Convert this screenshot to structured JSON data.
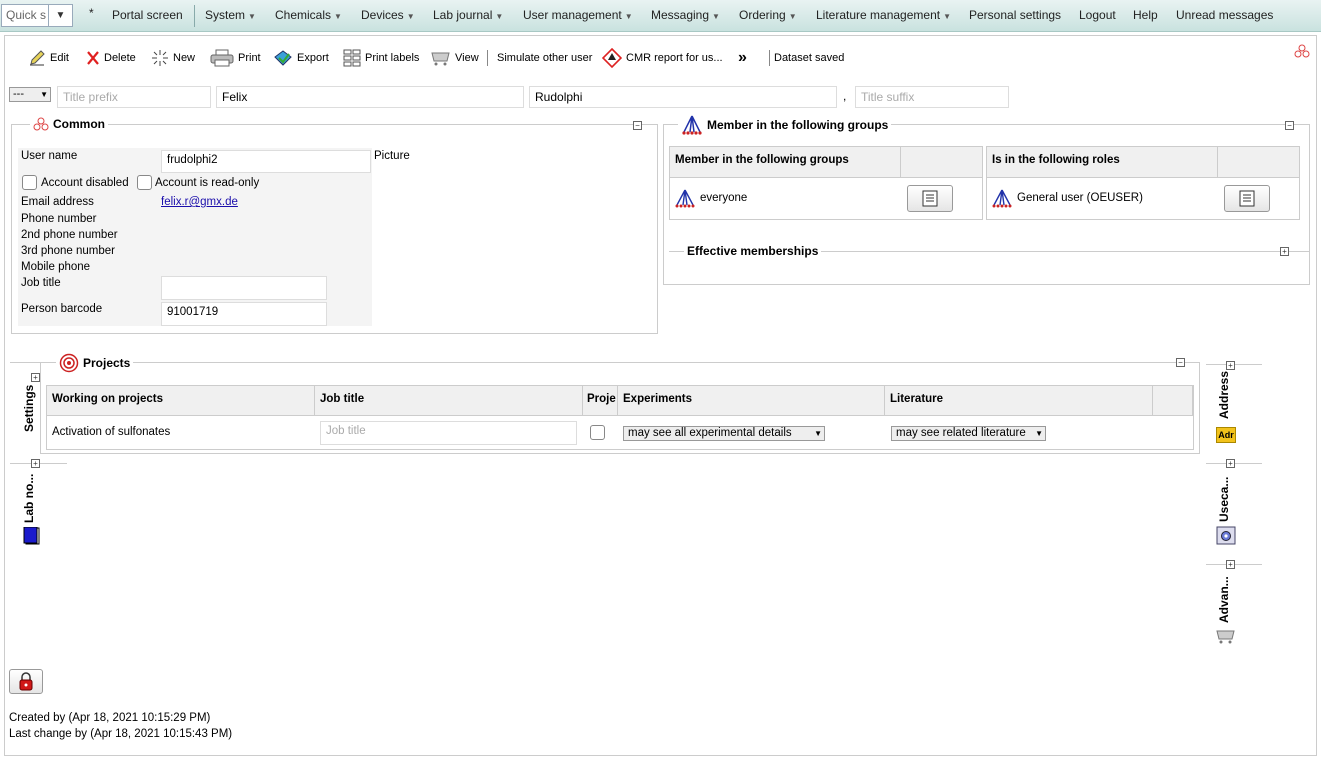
{
  "menu": {
    "quick_search_placeholder": "Quick s",
    "star": "*",
    "items": [
      "Portal screen",
      "System",
      "Chemicals",
      "Devices",
      "Lab journal",
      "User management",
      "Messaging",
      "Ordering",
      "Literature management",
      "Personal settings",
      "Logout",
      "Help",
      "Unread messages"
    ]
  },
  "toolbar": {
    "edit": "Edit",
    "delete": "Delete",
    "new": "New",
    "print": "Print",
    "export": "Export",
    "print_labels": "Print labels",
    "view": "View",
    "simulate": "Simulate other user",
    "cmr": "CMR report for us...",
    "more": "»",
    "status": "Dataset saved"
  },
  "name_row": {
    "salutation": "---",
    "title_prefix_placeholder": "Title prefix",
    "first_name": "Felix",
    "last_name": "Rudolphi",
    "comma": ",",
    "title_suffix_placeholder": "Title suffix"
  },
  "common": {
    "legend": "Common",
    "user_name_label": "User name",
    "user_name": "frudolphi2",
    "picture_label": "Picture",
    "account_disabled": "Account disabled",
    "account_readonly": "Account is read-only",
    "email_label": "Email address",
    "email": "felix.r@gmx.de",
    "phone_label": "Phone number",
    "phone2_label": "2nd phone number",
    "phone3_label": "3rd phone number",
    "mobile_label": "Mobile phone",
    "job_title_label": "Job title",
    "barcode_label": "Person barcode",
    "barcode": "91001719"
  },
  "groups": {
    "legend": "Member in the following groups",
    "groups_header": "Member in the following groups",
    "roles_header": "Is in the following roles",
    "group_item": "everyone",
    "role_item": "General user (OEUSER)",
    "effective_legend": "Effective memberships"
  },
  "projects": {
    "legend": "Projects",
    "headers": [
      "Working on projects",
      "Job title",
      "Proje",
      "Experiments",
      "Literature"
    ],
    "row": {
      "project": "Activation of sulfonates",
      "job_title_placeholder": "Job title",
      "experiments": "may see all experimental details",
      "literature": "may see related literature"
    }
  },
  "side_tabs": {
    "settings": "Settings",
    "lab_notebook": "Lab no...",
    "address": "Address",
    "address_icon_text": "Adr",
    "usecases": "Useca...",
    "advanced": "Advan..."
  },
  "footer": {
    "created": "Created by (Apr 18, 2021 10:15:29 PM)",
    "changed": "Last change by (Apr 18, 2021 10:15:43 PM)"
  },
  "colors": {
    "accent": "#c9e2df",
    "link": "#1a0dab",
    "group_icon": "#2233aa"
  }
}
